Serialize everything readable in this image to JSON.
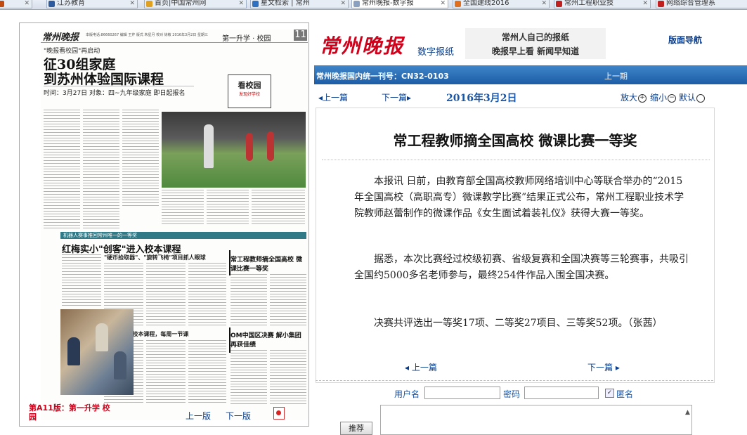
{
  "browser": {
    "tabs": [
      {
        "label": "",
        "active": false,
        "color": "#c04a10"
      },
      {
        "label": "江苏教育",
        "active": false,
        "color": "#2c5ba0"
      },
      {
        "label": "首页|中国常州网",
        "active": false,
        "color": "#e0a020"
      },
      {
        "label": "星文检索 | 常州",
        "active": false,
        "color": "#3070c0"
      },
      {
        "label": "常州晚报-数字报",
        "active": true,
        "color": "#8aa0c0"
      },
      {
        "label": "全国建线2016",
        "active": false,
        "color": "#e07020"
      },
      {
        "label": "常州工程职业技",
        "active": false,
        "color": "#c02020"
      },
      {
        "label": "网络综合管理系",
        "active": false,
        "color": "#c02020"
      }
    ]
  },
  "thumbnail": {
    "masthead": "常州晚报",
    "meta": "本版电话:86660267  编辑 王芹  版式 朱星月  校对 徐敏  2016年3月2日 星期三",
    "section": "第一升学 · 校园",
    "page_number": "11",
    "kicker": "\"晚报看校园\"再启动",
    "headline_1": "征30组家庭",
    "headline_2": "到苏州体验国际课程",
    "subline": "时间：3月27日  对象：四~九年级家庭  即日起报名",
    "badge_title": "看校园",
    "badge_sub": "发现好学校",
    "story2_bar": "机器人赛事推回常州唯一的一等奖",
    "story2_headline": "红梅实小\"创客\"进入校本课程",
    "story2_sub1": "\"硬币捡取器\"、\"旋转飞椅\"项目抓人眼球",
    "story2_sub2": "\"创客\"成为校本课程，每周一节课",
    "side1_headline": "常工程教师摘全国高校 微课比赛一等奖",
    "side2_headline": "OM中国区决赛 解小集团再获佳绩",
    "footer_title": "第A11版：第一升学 校园",
    "prev_page": "上一版",
    "next_page": "下一版"
  },
  "header": {
    "logo": "常州晚报",
    "logo_sub": "数字报纸",
    "slogan_1": "常州人自己的报纸",
    "slogan_2": "晚报早上看 新闻早知道",
    "nav_link": "版面导航"
  },
  "infobar": {
    "cn_number": "常州晚报国内统一刊号：CN32-0103",
    "prev_issue": "上一期"
  },
  "navrow": {
    "prev": "上一篇",
    "next": "下一篇",
    "date": "2016年3月2日",
    "zoom_in": "放大",
    "zoom_out": "缩小",
    "default": "默认"
  },
  "article": {
    "title": "常工程教师摘全国高校  微课比赛一等奖",
    "paragraphs": [
      "本报讯 日前，由教育部全国高校教师网络培训中心等联合举办的“2015年全国高校（高职高专）微课教学比赛”结果正式公布，常州工程职业技术学院教师赵蕾制作的微课作品《女生面试着装礼仪》获得大赛一等奖。",
      "据悉，本次比赛经过校级初赛、省级复赛和全国决赛等三轮赛事，共吸引全国约5000多名老师参与，最终254件作品入围全国决赛。",
      "决赛共评选出一等奖17项、二等奖27项目、三等奖52项。（张茜）"
    ],
    "prev": "上一篇",
    "next": "下一篇"
  },
  "comment": {
    "username_label": "用户名",
    "username_value": "",
    "password_label": "密码",
    "password_value": "",
    "anonymous_label": "匿名",
    "anonymous_checked": true,
    "submit_label": "推荐"
  }
}
